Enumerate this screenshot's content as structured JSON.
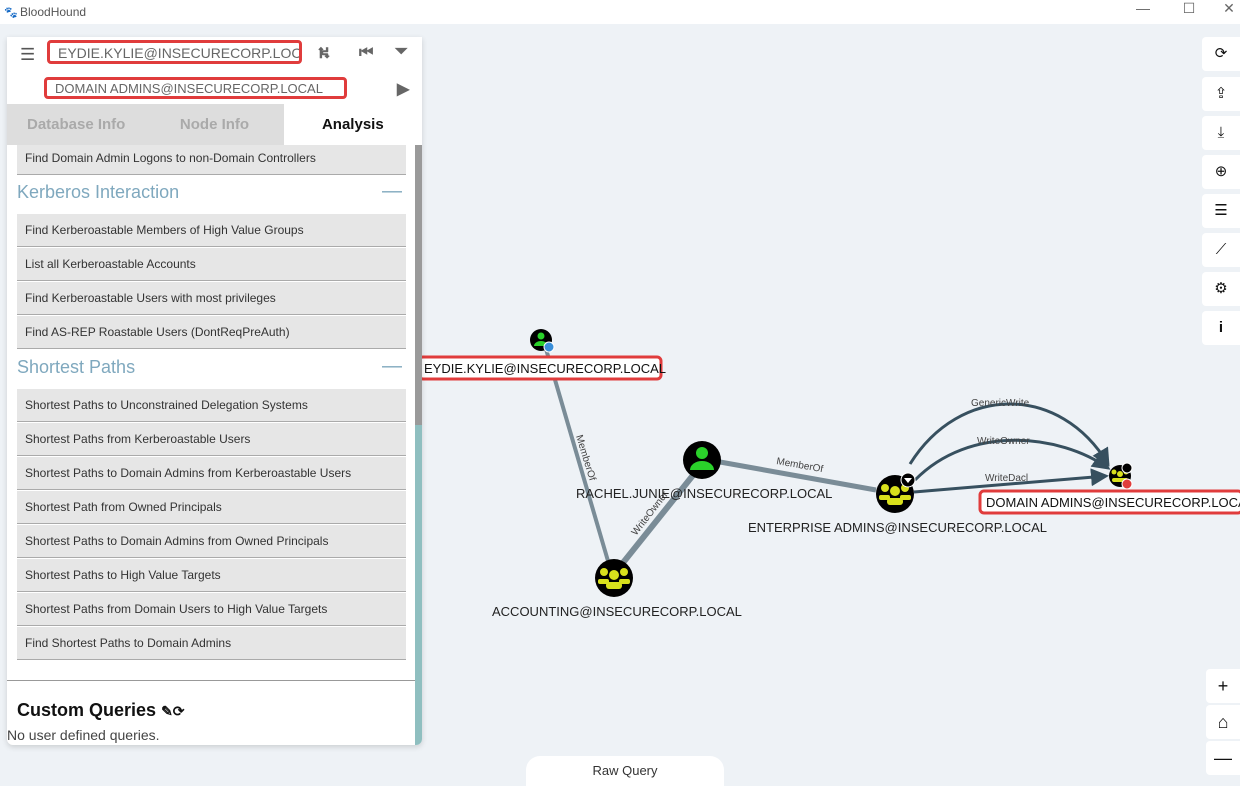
{
  "window": {
    "title": "BloodHound",
    "controls": [
      "—",
      "☐",
      "✕"
    ]
  },
  "search": {
    "start_value": "EYDIE.KYLIE@INSECURECORP.LOCAL",
    "target_value": "DOMAIN ADMINS@INSECURECORP.LOCAL"
  },
  "tabs": [
    {
      "label": "Database Info"
    },
    {
      "label": "Node Info"
    },
    {
      "label": "Analysis",
      "active": true
    }
  ],
  "analysis": {
    "top_item": "Find Domain Admin Logons to non-Domain Controllers",
    "sections": [
      {
        "title": "Kerberos Interaction",
        "items": [
          "Find Kerberoastable Members of High Value Groups",
          "List all Kerberoastable Accounts",
          "Find Kerberoastable Users with most privileges",
          "Find AS-REP Roastable Users (DontReqPreAuth)"
        ]
      },
      {
        "title": "Shortest Paths",
        "items": [
          "Shortest Paths to Unconstrained Delegation Systems",
          "Shortest Paths from Kerberoastable Users",
          "Shortest Paths to Domain Admins from Kerberoastable Users",
          "Shortest Path from Owned Principals",
          "Shortest Paths to Domain Admins from Owned Principals",
          "Shortest Paths to High Value Targets",
          "Shortest Paths from Domain Users to High Value Targets",
          "Find Shortest Paths to Domain Admins"
        ]
      }
    ],
    "collapse_symbol": "—"
  },
  "custom_queries": {
    "title": "Custom Queries",
    "empty_text": "No user defined queries."
  },
  "raw_query": {
    "label": "Raw Query"
  },
  "graph": {
    "nodes": [
      {
        "id": "eydie",
        "label": "EYDIE.KYLIE@INSECURECORP.LOCAL",
        "type": "user",
        "highlighted": true
      },
      {
        "id": "rachel",
        "label": "RACHEL.JUNIE@INSECURECORP.LOCAL",
        "type": "user"
      },
      {
        "id": "accounting",
        "label": "ACCOUNTING@INSECURECORP.LOCAL",
        "type": "group"
      },
      {
        "id": "enterprise",
        "label": "ENTERPRISE ADMINS@INSECURECORP.LOCAL",
        "type": "group"
      },
      {
        "id": "domainadmins",
        "label": "DOMAIN ADMINS@INSECURECORP.LOCAL",
        "type": "group",
        "highlighted": true
      }
    ],
    "edges": [
      {
        "from": "eydie",
        "to": "accounting",
        "label": "MemberOf"
      },
      {
        "from": "accounting",
        "to": "rachel",
        "label": "WriteOwner"
      },
      {
        "from": "rachel",
        "to": "enterprise",
        "label": "MemberOf"
      },
      {
        "from": "enterprise",
        "to": "domainadmins",
        "label": "GenericWrite"
      },
      {
        "from": "enterprise",
        "to": "domainadmins",
        "label": "WriteOwner"
      },
      {
        "from": "enterprise",
        "to": "domainadmins",
        "label": "WriteDacl"
      }
    ],
    "colors": {
      "user": "#2ad12a",
      "group": "#d8e01c",
      "edge": "#37505f",
      "highlight": "#e03c3c"
    }
  },
  "toolbar": [
    "refresh-icon",
    "upload-icon",
    "download-icon",
    "import-icon",
    "queries-icon",
    "chart-icon",
    "settings-icon",
    "info-icon"
  ],
  "zoom": {
    "in": "+",
    "home": "⌂",
    "out": "—"
  }
}
